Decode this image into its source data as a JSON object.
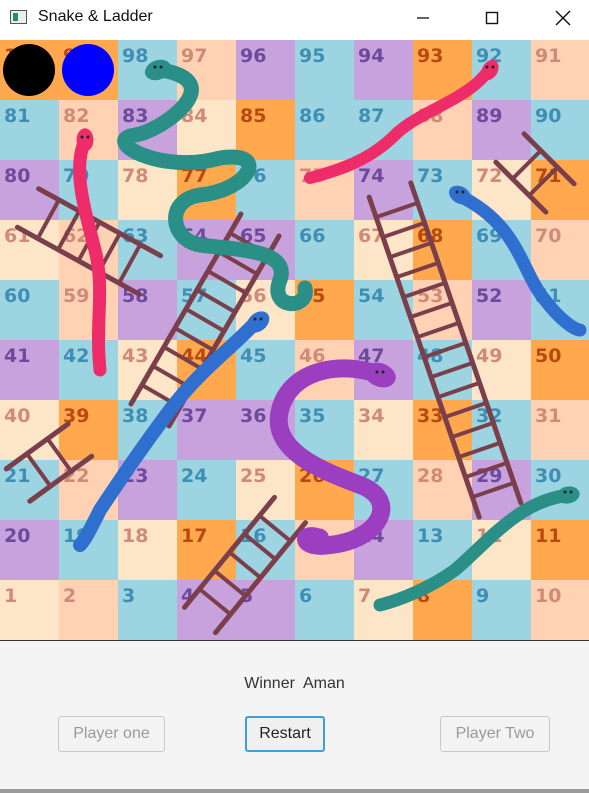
{
  "window": {
    "title": "Snake & Ladder"
  },
  "board": {
    "cells": [
      [
        100,
        99,
        98,
        97,
        96,
        95,
        94,
        93,
        92,
        91
      ],
      [
        81,
        82,
        83,
        84,
        85,
        86,
        87,
        88,
        89,
        90
      ],
      [
        80,
        79,
        78,
        77,
        76,
        75,
        74,
        73,
        72,
        71
      ],
      [
        61,
        62,
        63,
        64,
        65,
        66,
        67,
        68,
        69,
        70
      ],
      [
        60,
        59,
        58,
        57,
        56,
        55,
        54,
        53,
        52,
        51
      ],
      [
        41,
        42,
        43,
        44,
        45,
        46,
        47,
        48,
        49,
        50
      ],
      [
        40,
        39,
        38,
        37,
        36,
        35,
        34,
        33,
        32,
        31
      ],
      [
        21,
        22,
        23,
        24,
        25,
        26,
        27,
        28,
        29,
        30
      ],
      [
        20,
        19,
        18,
        17,
        16,
        15,
        14,
        13,
        12,
        11
      ],
      [
        1,
        2,
        3,
        4,
        5,
        6,
        7,
        8,
        9,
        10
      ]
    ],
    "palette": {
      "orange": "#ffa84d",
      "teal": "#9dd4e1",
      "purple": "#c8a2dc",
      "cream": "#fde5c8",
      "salmon": "#ffd2b4"
    },
    "snake_colors": [
      "#2a8f86",
      "#ef2c6a",
      "#2f6fd0",
      "#9b3fc0"
    ],
    "ladder_color": "#7b3f4c"
  },
  "tokens": [
    {
      "name": "player-one-token",
      "color": "#000000"
    },
    {
      "name": "player-two-token",
      "color": "#0000ff"
    }
  ],
  "status": {
    "winner_text": "Winner  Aman"
  },
  "controls": {
    "player_one_label": "Player one",
    "restart_label": "Restart",
    "player_two_label": "Player Two"
  }
}
